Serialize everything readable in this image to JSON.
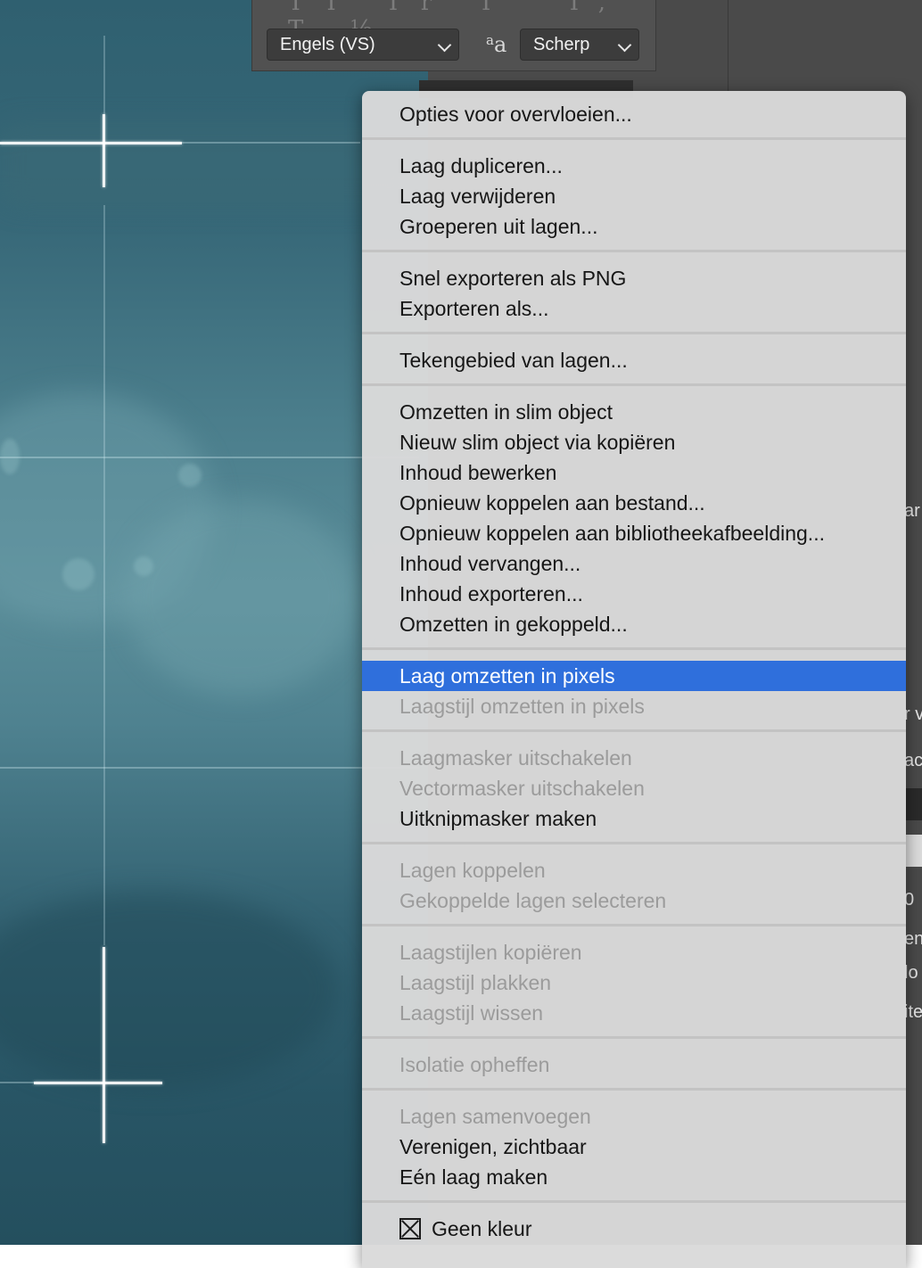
{
  "toolbar": {
    "language_select": "Engels (VS)",
    "antialias_select": "Scherp",
    "antialias_icon": "a-a-antialias-icon"
  },
  "right_panel": {
    "peek_texts": [
      "ar",
      "r v",
      "ac",
      "0",
      "en",
      "lo",
      "ite"
    ]
  },
  "menu": {
    "groups": [
      [
        {
          "label": "Opties voor overvloeien...",
          "enabled": true
        }
      ],
      [
        {
          "label": "Laag dupliceren...",
          "enabled": true
        },
        {
          "label": "Laag verwijderen",
          "enabled": true
        },
        {
          "label": "Groeperen uit lagen...",
          "enabled": true
        }
      ],
      [
        {
          "label": "Snel exporteren als PNG",
          "enabled": true
        },
        {
          "label": "Exporteren als...",
          "enabled": true
        }
      ],
      [
        {
          "label": "Tekengebied van lagen...",
          "enabled": true
        }
      ],
      [
        {
          "label": "Omzetten in slim object",
          "enabled": true
        },
        {
          "label": "Nieuw slim object via kopiëren",
          "enabled": true
        },
        {
          "label": "Inhoud bewerken",
          "enabled": true
        },
        {
          "label": "Opnieuw koppelen aan bestand...",
          "enabled": true
        },
        {
          "label": "Opnieuw koppelen aan bibliotheekafbeelding...",
          "enabled": true
        },
        {
          "label": "Inhoud vervangen...",
          "enabled": true
        },
        {
          "label": "Inhoud exporteren...",
          "enabled": true
        },
        {
          "label": "Omzetten in gekoppeld...",
          "enabled": true
        }
      ],
      [
        {
          "label": "Laag omzetten in pixels",
          "enabled": true,
          "highlighted": true
        },
        {
          "label": "Laagstijl omzetten in pixels",
          "enabled": false
        }
      ],
      [
        {
          "label": "Laagmasker uitschakelen",
          "enabled": false
        },
        {
          "label": "Vectormasker uitschakelen",
          "enabled": false
        },
        {
          "label": "Uitknipmasker maken",
          "enabled": true
        }
      ],
      [
        {
          "label": "Lagen koppelen",
          "enabled": false
        },
        {
          "label": "Gekoppelde lagen selecteren",
          "enabled": false
        }
      ],
      [
        {
          "label": "Laagstijlen kopiëren",
          "enabled": false
        },
        {
          "label": "Laagstijl plakken",
          "enabled": false
        },
        {
          "label": "Laagstijl wissen",
          "enabled": false
        }
      ],
      [
        {
          "label": "Isolatie opheffen",
          "enabled": false
        }
      ],
      [
        {
          "label": "Lagen samenvoegen",
          "enabled": false
        },
        {
          "label": "Verenigen, zichtbaar",
          "enabled": true
        },
        {
          "label": "Eén laag maken",
          "enabled": true
        }
      ],
      [
        {
          "label": "Geen kleur",
          "enabled": true,
          "icon": "x-box-icon"
        }
      ]
    ],
    "highlight_color": "#2f6fdc"
  }
}
